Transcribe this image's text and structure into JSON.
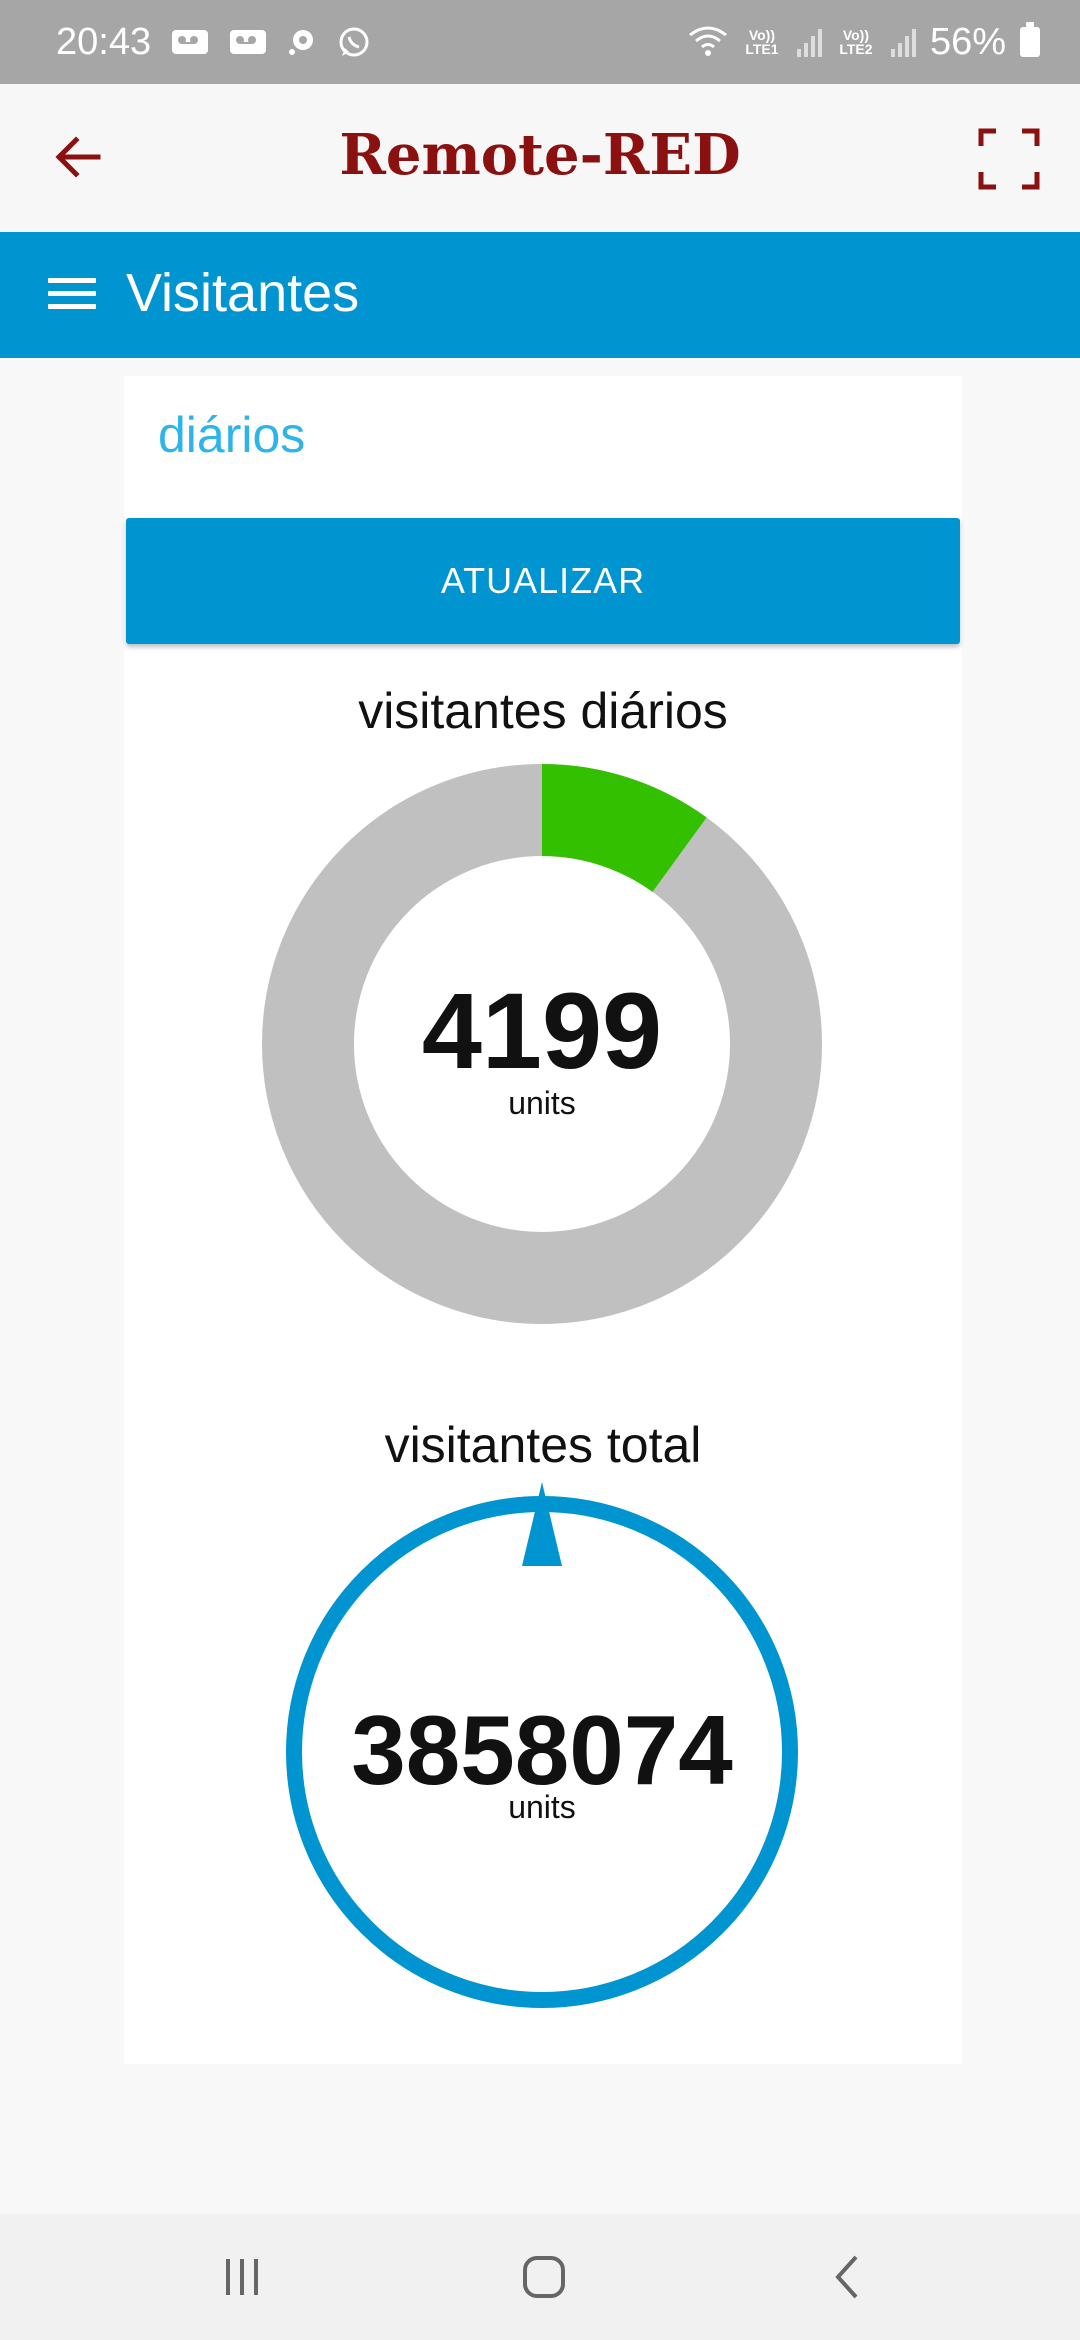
{
  "status_bar": {
    "time": "20:43",
    "sim1_label": "Vo))\nLTE1",
    "sim2_label": "Vo))\nLTE2",
    "battery": "56%",
    "color": "#a6a6a6"
  },
  "app": {
    "title": "Remote-RED",
    "title_color": "#8b1010"
  },
  "toolbar": {
    "title": "Visitantes",
    "color": "#0095d1"
  },
  "group": {
    "title": "diários",
    "refresh_label": "ATUALIZAR"
  },
  "gauges": [
    {
      "title": "visitantes diários",
      "value": "4199",
      "units": "units",
      "type": "donut",
      "fraction": 0.1,
      "fill_color": "#33c000",
      "track_color": "#c0c0c0"
    },
    {
      "title": "visitantes total",
      "value": "3858074",
      "units": "units",
      "type": "compass",
      "ring_color": "#0094d0"
    }
  ],
  "nav_bar": {
    "recents_icon": "recents-icon",
    "home_icon": "home-icon",
    "back_icon": "back-icon"
  }
}
